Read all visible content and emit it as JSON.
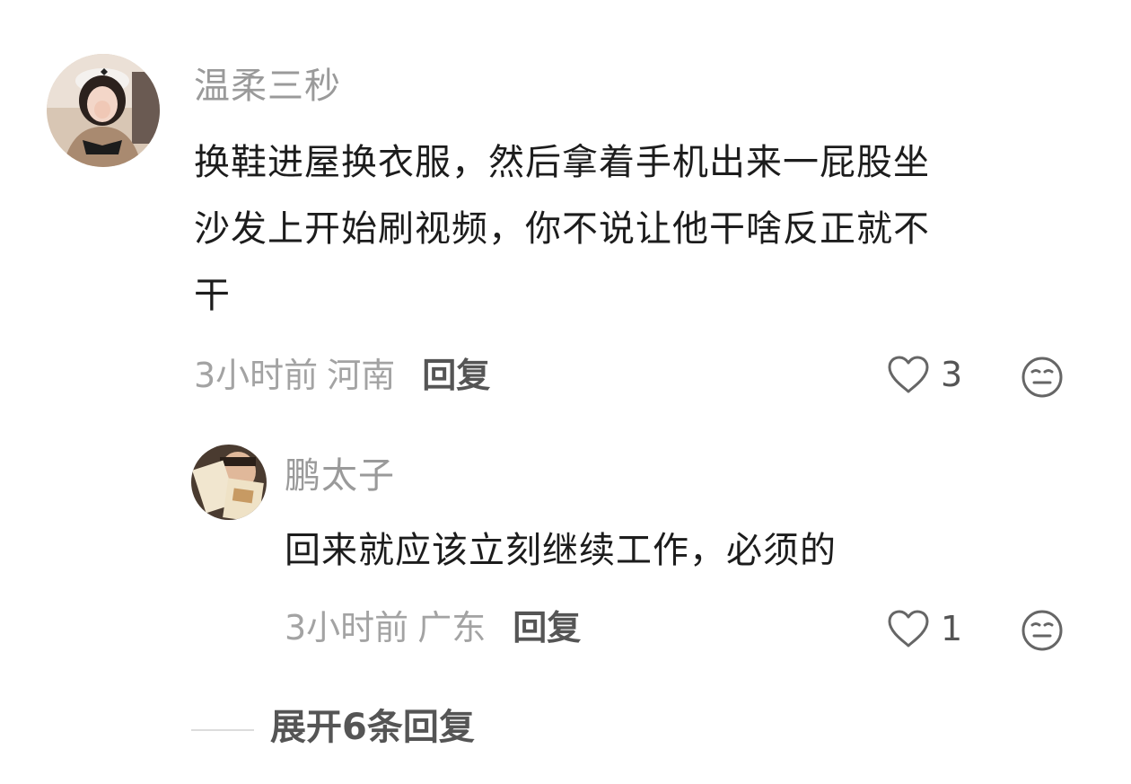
{
  "comment": {
    "username": "温柔三秒",
    "text_lines": [
      "换鞋进屋换衣服，然后拿着手机出来一屁股坐",
      "沙发上开始刷视频，你不说让他干啥反正就不",
      "干"
    ],
    "time": "3小时前",
    "location": "河南",
    "reply_label": "回复",
    "like_count": "3",
    "like_icon": "heart-outline-icon",
    "emoji_icon": "smiley-face-icon"
  },
  "reply": {
    "username": "鹏太子",
    "text_lines": [
      "回来就应该立刻继续工作，必须的"
    ],
    "time": "3小时前",
    "location": "广东",
    "reply_label": "回复",
    "like_count": "1",
    "like_icon": "heart-outline-icon",
    "emoji_icon": "smiley-face-icon"
  },
  "expand": {
    "label": "展开6条回复"
  },
  "colors": {
    "username": "#9a9a9a",
    "text": "#1c1c1c",
    "meta": "#a3a3a3",
    "action": "#555555",
    "divider": "#dcdcdc"
  }
}
